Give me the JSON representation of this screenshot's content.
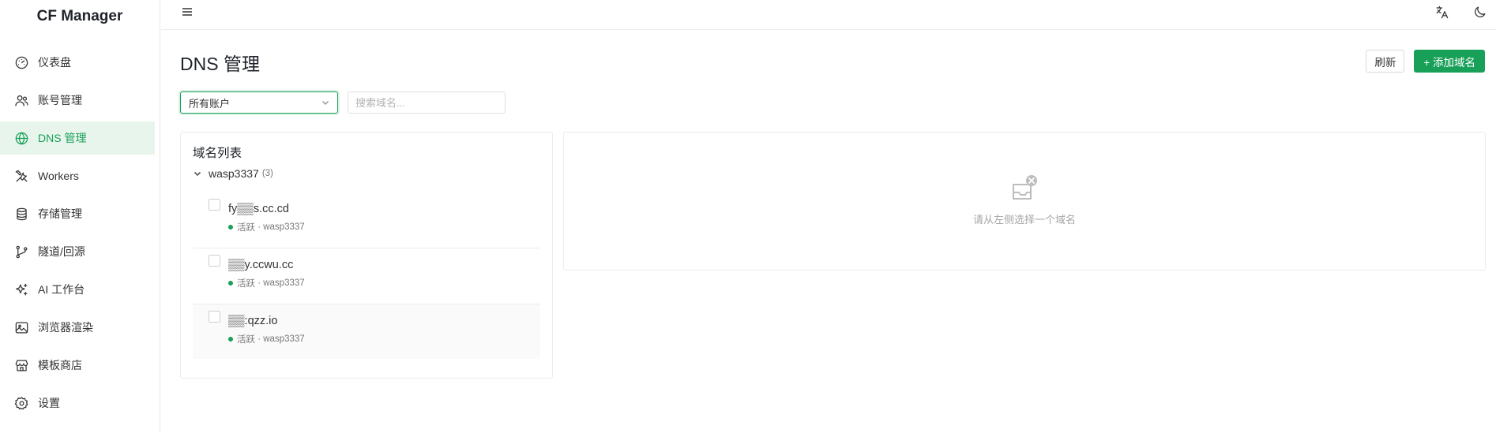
{
  "app": {
    "title": "CF Manager"
  },
  "sidebar": {
    "items": [
      {
        "label": "仪表盘",
        "icon": "dashboard-icon",
        "active": false
      },
      {
        "label": "账号管理",
        "icon": "users-icon",
        "active": false
      },
      {
        "label": "DNS 管理",
        "icon": "globe-icon",
        "active": true
      },
      {
        "label": "Workers",
        "icon": "tools-icon",
        "active": false
      },
      {
        "label": "存储管理",
        "icon": "database-icon",
        "active": false
      },
      {
        "label": "隧道/回源",
        "icon": "git-branch-icon",
        "active": false
      },
      {
        "label": "AI 工作台",
        "icon": "sparkles-icon",
        "active": false
      },
      {
        "label": "浏览器渲染",
        "icon": "image-icon",
        "active": false
      },
      {
        "label": "模板商店",
        "icon": "store-icon",
        "active": false
      },
      {
        "label": "设置",
        "icon": "gear-icon",
        "active": false
      }
    ]
  },
  "header": {
    "menu_icon": "menu-icon",
    "right_icons": [
      "translate-icon",
      "moon-icon"
    ]
  },
  "page": {
    "title": "DNS 管理",
    "refresh_label": "刷新",
    "add_domain_label": "+ 添加域名",
    "account_select": {
      "value": "所有账户"
    },
    "search": {
      "placeholder": "搜索域名..."
    }
  },
  "domain_panel": {
    "title": "域名列表",
    "group": {
      "name": "wasp3337",
      "count": "(3)"
    },
    "domains": [
      {
        "name": "fy▒▒s.cc.cd",
        "status": "活跃",
        "account": "wasp3337"
      },
      {
        "name": "▒▒y.ccwu.cc",
        "status": "活跃",
        "account": "wasp3337"
      },
      {
        "name": "▒▒:qzz.io",
        "status": "活跃",
        "account": "wasp3337"
      }
    ]
  },
  "detail_panel": {
    "empty_text": "请从左侧选择一个域名"
  },
  "colors": {
    "accent": "#18a058",
    "active_bg": "#e8f5ec"
  }
}
